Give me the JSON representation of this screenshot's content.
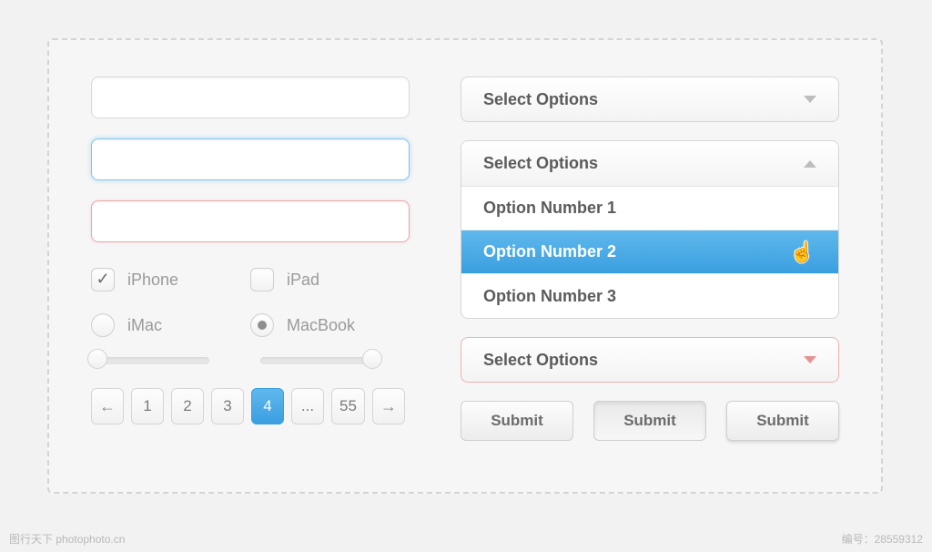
{
  "inputs": {
    "default": "",
    "focused": "",
    "error": ""
  },
  "checkboxes": {
    "item1": {
      "label": "iPhone",
      "checked": true
    },
    "item2": {
      "label": "iPad",
      "checked": false
    }
  },
  "radios": {
    "item1": {
      "label": "iMac",
      "selected": false
    },
    "item2": {
      "label": "MacBook",
      "selected": true
    }
  },
  "pagination": {
    "prev": "←",
    "next": "→",
    "pages": [
      "1",
      "2",
      "3",
      "4",
      "...",
      "55"
    ],
    "active_index": 3
  },
  "selects": {
    "closed": "Select Options",
    "open": {
      "label": "Select Options",
      "options": [
        "Option Number 1",
        "Option Number 2",
        "Option Number 3"
      ],
      "hover_index": 1
    },
    "error": "Select Options"
  },
  "buttons": {
    "submit1": "Submit",
    "submit2": "Submit",
    "submit3": "Submit"
  },
  "footer": {
    "left": "图行天下 photophoto.cn",
    "right": "编号：28559312"
  }
}
